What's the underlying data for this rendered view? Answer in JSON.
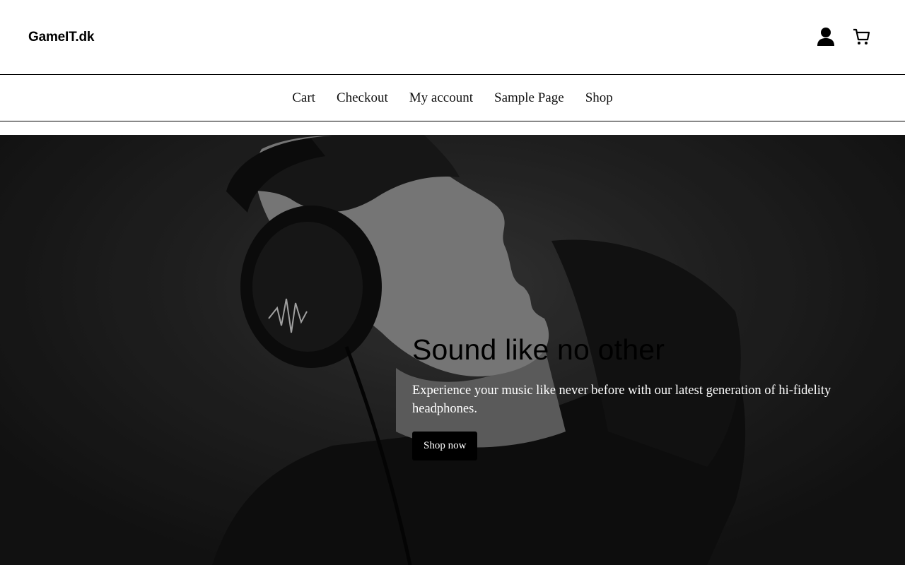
{
  "header": {
    "site_title": "GameIT.dk",
    "icons": [
      "user-icon",
      "cart-icon"
    ]
  },
  "nav": {
    "items": [
      {
        "label": "Cart"
      },
      {
        "label": "Checkout"
      },
      {
        "label": "My account"
      },
      {
        "label": "Sample Page"
      },
      {
        "label": "Shop"
      }
    ]
  },
  "hero": {
    "heading": "Sound like no other",
    "text": "Experience your music like never before with our latest generation of hi-fidelity headphones.",
    "button_label": "Shop now",
    "image_subject": "man-wearing-headphones-photo",
    "colors": {
      "overlay": "#1e1e1e",
      "button_bg": "#000000",
      "text": "#ffffff"
    }
  }
}
